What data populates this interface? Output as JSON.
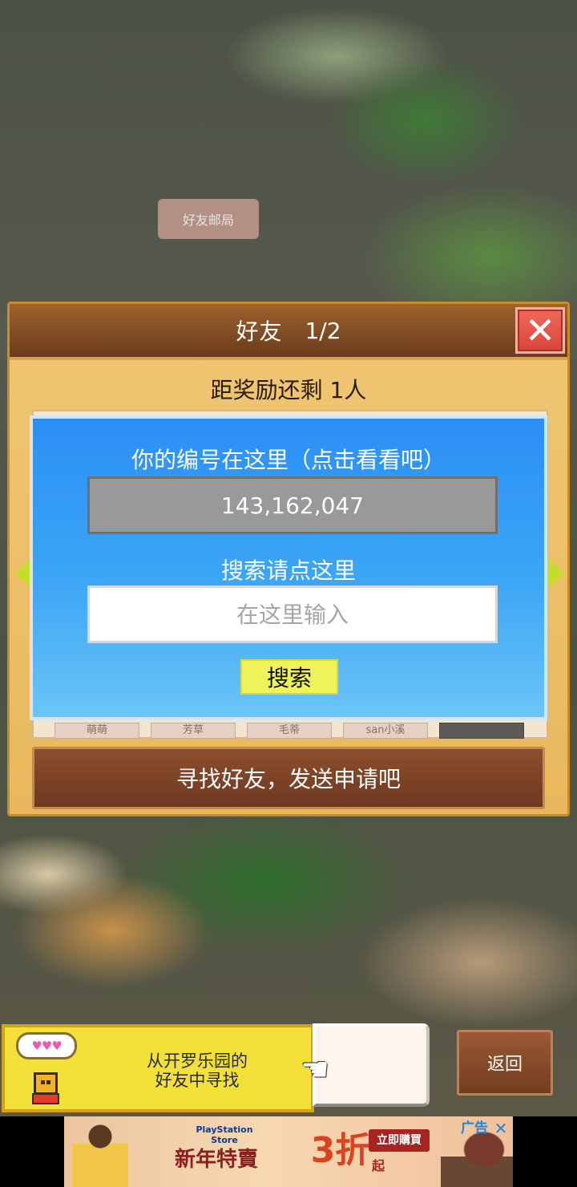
{
  "background": {
    "building_label": "好友邮局"
  },
  "panel": {
    "title": "好友",
    "page_indicator": "1/2",
    "reward_text": "距奖励还剩 1人",
    "friend_tabs": [
      "萌萌",
      "芳草",
      "毛蒂",
      "san小溪",
      ""
    ],
    "find_friends_button": "寻找好友，发送申请吧"
  },
  "dialog": {
    "id_label": "你的编号在这里（点击看看吧）",
    "player_id": "143,162,047",
    "search_label": "搜索请点这里",
    "search_placeholder": "在这里输入",
    "search_button": "搜索"
  },
  "bottom": {
    "speech_hearts": "♥♥♥",
    "hint_text_line1": "从开罗乐园的",
    "hint_text_line2": "好友中寻找",
    "back_button": "返回"
  },
  "ad": {
    "store_name": "PlayStation Store",
    "headline": "新年特賣",
    "discount": "3折",
    "discount_suffix": "起",
    "buy_button": "立即購買",
    "ad_label": "广告",
    "close_symbol": "✕"
  },
  "colors": {
    "dialog_blue": "#2b8ff5",
    "header_brown": "#7e4a22",
    "panel_gold": "#f0c774",
    "search_yellow": "#f0f25a",
    "close_red": "#d8443a"
  }
}
